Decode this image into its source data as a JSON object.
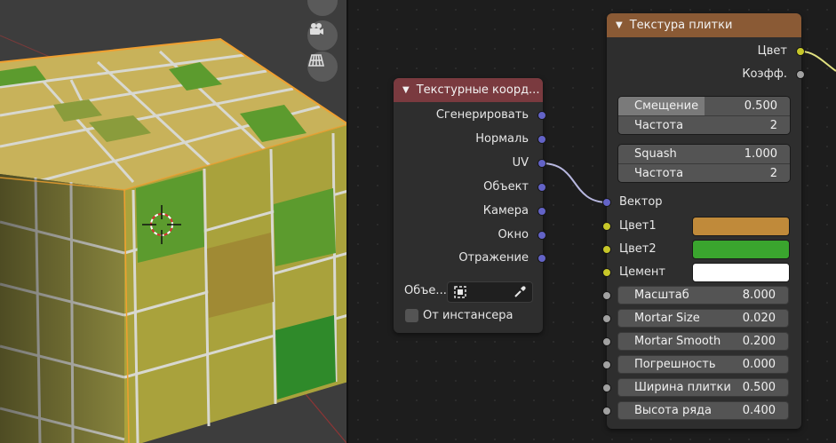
{
  "viewport": {
    "buttons": [
      {
        "icon": "hand-icon"
      },
      {
        "icon": "camera-icon"
      },
      {
        "icon": "grid-icon"
      }
    ],
    "colors": {
      "background": "#3d3d3d",
      "tile_gold": "#b08a3c",
      "tile_green": "#5c9b2e",
      "mortar": "#dcdcdc",
      "selection_outline": "#f0a030"
    }
  },
  "tex_coord_node": {
    "title": "Текстурные коорд...",
    "header_color": "#7a3a3f",
    "outputs": [
      "Сгенерировать",
      "Нормаль",
      "UV",
      "Объект",
      "Камера",
      "Окно",
      "Отражение"
    ],
    "object_label": "Объе...",
    "from_instancer_label": "От инстансера"
  },
  "brick_node": {
    "title": "Текстура плитки",
    "header_color": "#8a5a35",
    "outputs": [
      "Цвет",
      "Коэфф."
    ],
    "offset": {
      "label": "Смещение",
      "value": "0.500",
      "fraction": 0.5
    },
    "frequency1": {
      "label": "Частота",
      "value": "2"
    },
    "squash": {
      "label": "Squash",
      "value": "1.000"
    },
    "frequency2": {
      "label": "Частота",
      "value": "2"
    },
    "vector_label": "Вектор",
    "color1": {
      "label": "Цвет1",
      "color": "#c08a3a"
    },
    "color2": {
      "label": "Цвет2",
      "color": "#3aa52e"
    },
    "mortar": {
      "label": "Цемент",
      "color": "#ffffff"
    },
    "scale": {
      "label": "Масштаб",
      "value": "8.000"
    },
    "mortar_size": {
      "label": "Mortar Size",
      "value": "0.020"
    },
    "mortar_smooth": {
      "label": "Mortar Smooth",
      "value": "0.200"
    },
    "bias": {
      "label": "Погрешность",
      "value": "0.000"
    },
    "brick_width": {
      "label": "Ширина плитки",
      "value": "0.500"
    },
    "row_height": {
      "label": "Высота ряда",
      "value": "0.400"
    }
  }
}
